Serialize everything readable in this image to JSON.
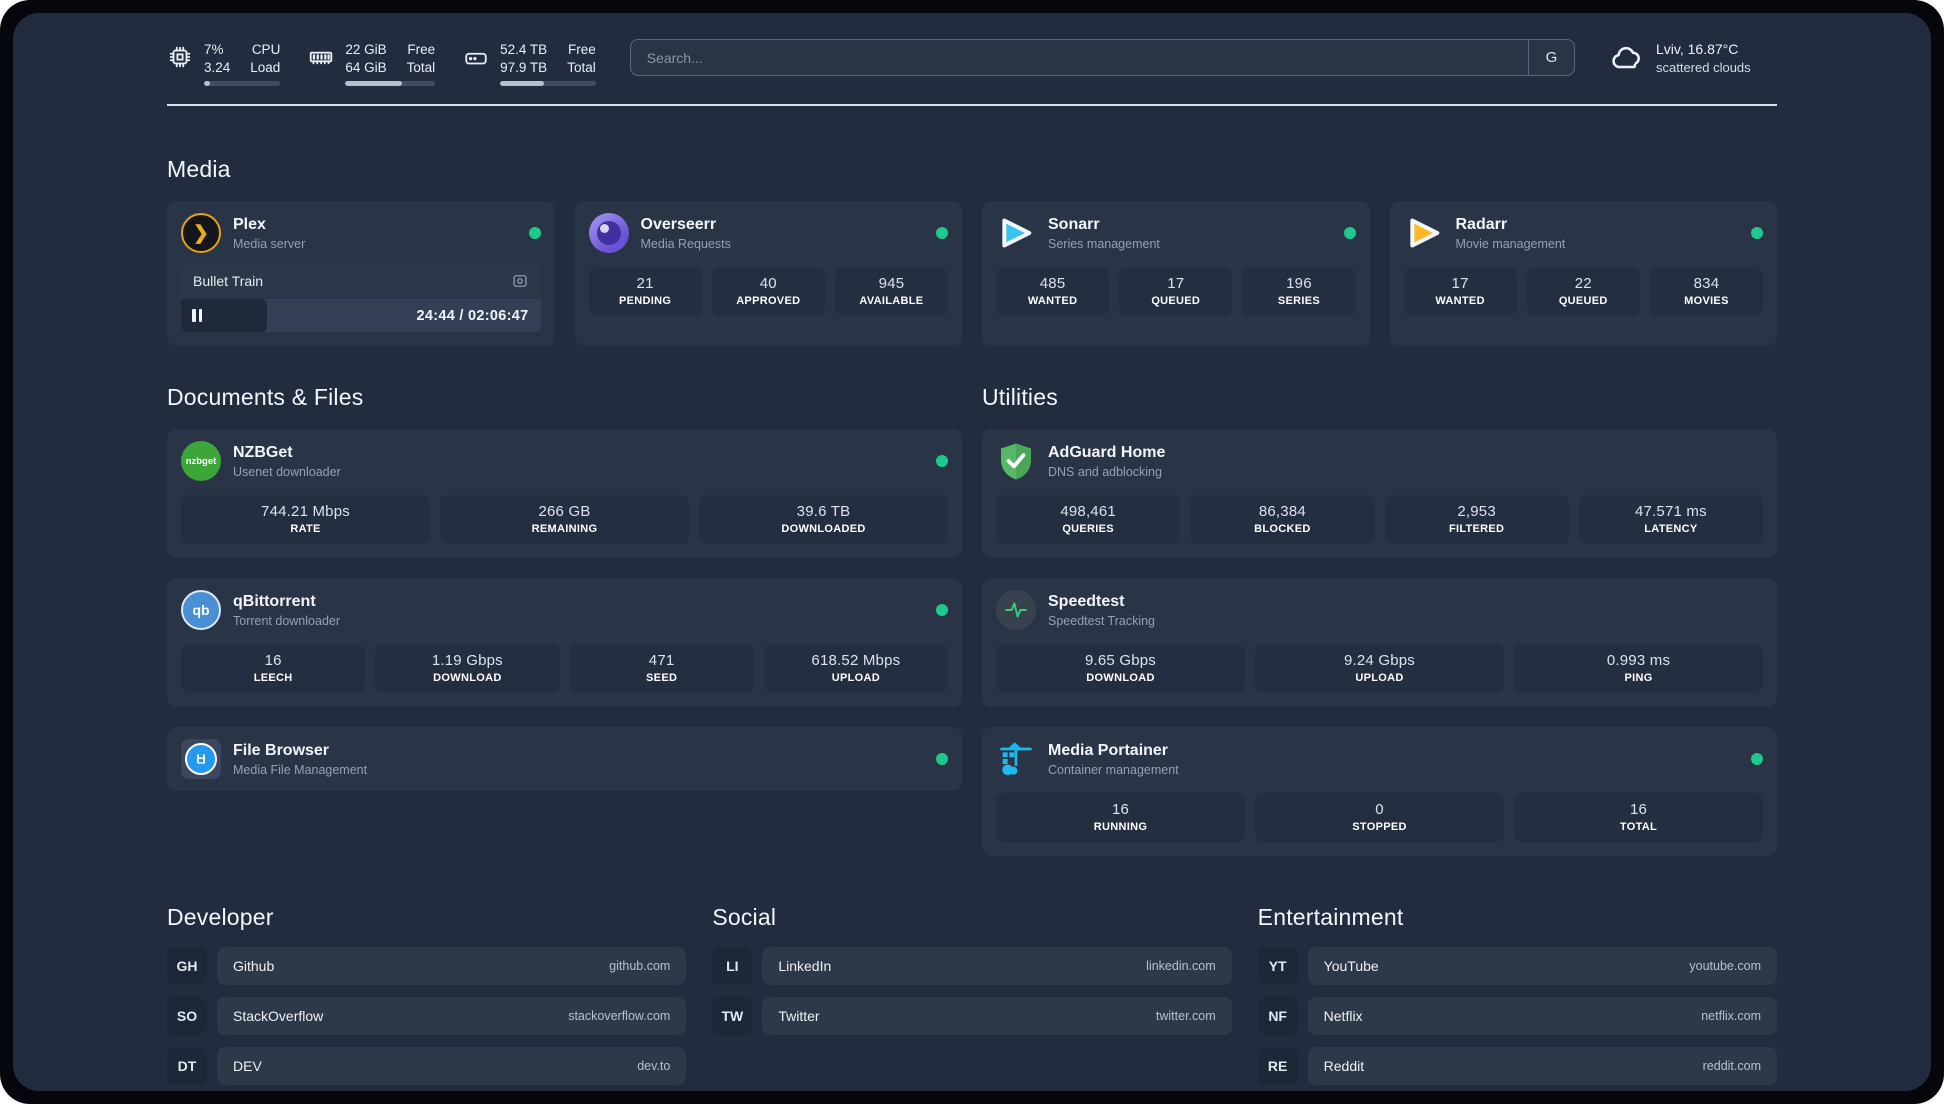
{
  "colors": {
    "background": "#222c3e",
    "card": "#2a3447",
    "stat_box": "#232e40",
    "status_online": "#1ec98c",
    "plex_accent": "#e6a116",
    "sonarr_accent": "#36c3f1",
    "radarr_accent": "#ffb928",
    "nzbget_accent": "#3da639",
    "adguard_accent": "#59b868",
    "qbittorrent_accent": "#4a8fd4",
    "speedtest_accent": "#35d07a",
    "portainer_accent": "#1fb9ed",
    "filebrowser_accent": "#2499ee",
    "overseerr_accent": "#6a53d6"
  },
  "system": {
    "cpu": {
      "value_line1": "7%",
      "value_line2": "3.24",
      "label_line1": "CPU",
      "label_line2": "Load",
      "progress_pct": 7,
      "bar_style": "width:8%"
    },
    "memory": {
      "value_line1": "22 GiB",
      "value_line2": "64 GiB",
      "label_line1": "Free",
      "label_line2": "Total",
      "progress_pct": 63,
      "bar_style": "width:63%"
    },
    "disk": {
      "value_line1": "52.4 TB",
      "value_line2": "97.9 TB",
      "label_line1": "Free",
      "label_line2": "Total",
      "progress_pct": 46,
      "bar_style": "width:46%"
    }
  },
  "search": {
    "placeholder": "Search...",
    "engine_label": "G"
  },
  "weather": {
    "location_temp": "Lviv, 16.87°C",
    "condition": "scattered clouds"
  },
  "media": {
    "title": "Media",
    "plex": {
      "name": "Plex",
      "desc": "Media server",
      "online": true,
      "player": {
        "track": "Bullet Train",
        "time": "24:44 / 02:06:47",
        "progress_pct": 20,
        "fill_style": "width:24%"
      }
    },
    "overseerr": {
      "name": "Overseerr",
      "desc": "Media Requests",
      "online": true,
      "stats": [
        {
          "value": "21",
          "label": "PENDING"
        },
        {
          "value": "40",
          "label": "APPROVED"
        },
        {
          "value": "945",
          "label": "AVAILABLE"
        }
      ]
    },
    "sonarr": {
      "name": "Sonarr",
      "desc": "Series management",
      "online": true,
      "stats": [
        {
          "value": "485",
          "label": "WANTED"
        },
        {
          "value": "17",
          "label": "QUEUED"
        },
        {
          "value": "196",
          "label": "SERIES"
        }
      ]
    },
    "radarr": {
      "name": "Radarr",
      "desc": "Movie management",
      "online": true,
      "stats": [
        {
          "value": "17",
          "label": "WANTED"
        },
        {
          "value": "22",
          "label": "QUEUED"
        },
        {
          "value": "834",
          "label": "MOVIES"
        }
      ]
    }
  },
  "documents": {
    "title": "Documents & Files",
    "nzbget": {
      "name": "NZBGet",
      "desc": "Usenet downloader",
      "online": true,
      "logo_text": "nzbget",
      "stats": [
        {
          "value": "744.21 Mbps",
          "label": "RATE"
        },
        {
          "value": "266 GB",
          "label": "REMAINING"
        },
        {
          "value": "39.6 TB",
          "label": "DOWNLOADED"
        }
      ]
    },
    "qbittorrent": {
      "name": "qBittorrent",
      "desc": "Torrent downloader",
      "online": true,
      "logo_text": "qb",
      "stats": [
        {
          "value": "16",
          "label": "LEECH"
        },
        {
          "value": "1.19 Gbps",
          "label": "DOWNLOAD"
        },
        {
          "value": "471",
          "label": "SEED"
        },
        {
          "value": "618.52 Mbps",
          "label": "UPLOAD"
        }
      ]
    },
    "filebrowser": {
      "name": "File Browser",
      "desc": "Media File Management",
      "online": true
    }
  },
  "utilities": {
    "title": "Utilities",
    "adguard": {
      "name": "AdGuard Home",
      "desc": "DNS and adblocking",
      "stats": [
        {
          "value": "498,461",
          "label": "QUERIES"
        },
        {
          "value": "86,384",
          "label": "BLOCKED"
        },
        {
          "value": "2,953",
          "label": "FILTERED"
        },
        {
          "value": "47.571 ms",
          "label": "LATENCY"
        }
      ]
    },
    "speedtest": {
      "name": "Speedtest",
      "desc": "Speedtest Tracking",
      "stats": [
        {
          "value": "9.65 Gbps",
          "label": "DOWNLOAD"
        },
        {
          "value": "9.24 Gbps",
          "label": "UPLOAD"
        },
        {
          "value": "0.993 ms",
          "label": "PING"
        }
      ]
    },
    "portainer": {
      "name": "Media Portainer",
      "desc": "Container management",
      "online": true,
      "stats": [
        {
          "value": "16",
          "label": "RUNNING"
        },
        {
          "value": "0",
          "label": "STOPPED"
        },
        {
          "value": "16",
          "label": "TOTAL"
        }
      ]
    }
  },
  "links": {
    "developer": {
      "title": "Developer",
      "items": [
        {
          "tag": "GH",
          "name": "Github",
          "domain": "github.com"
        },
        {
          "tag": "SO",
          "name": "StackOverflow",
          "domain": "stackoverflow.com"
        },
        {
          "tag": "DT",
          "name": "DEV",
          "domain": "dev.to"
        }
      ]
    },
    "social": {
      "title": "Social",
      "items": [
        {
          "tag": "LI",
          "name": "LinkedIn",
          "domain": "linkedin.com"
        },
        {
          "tag": "TW",
          "name": "Twitter",
          "domain": "twitter.com"
        }
      ]
    },
    "entertainment": {
      "title": "Entertainment",
      "items": [
        {
          "tag": "YT",
          "name": "YouTube",
          "domain": "youtube.com"
        },
        {
          "tag": "NF",
          "name": "Netflix",
          "domain": "netflix.com"
        },
        {
          "tag": "RE",
          "name": "Reddit",
          "domain": "reddit.com"
        }
      ]
    }
  }
}
